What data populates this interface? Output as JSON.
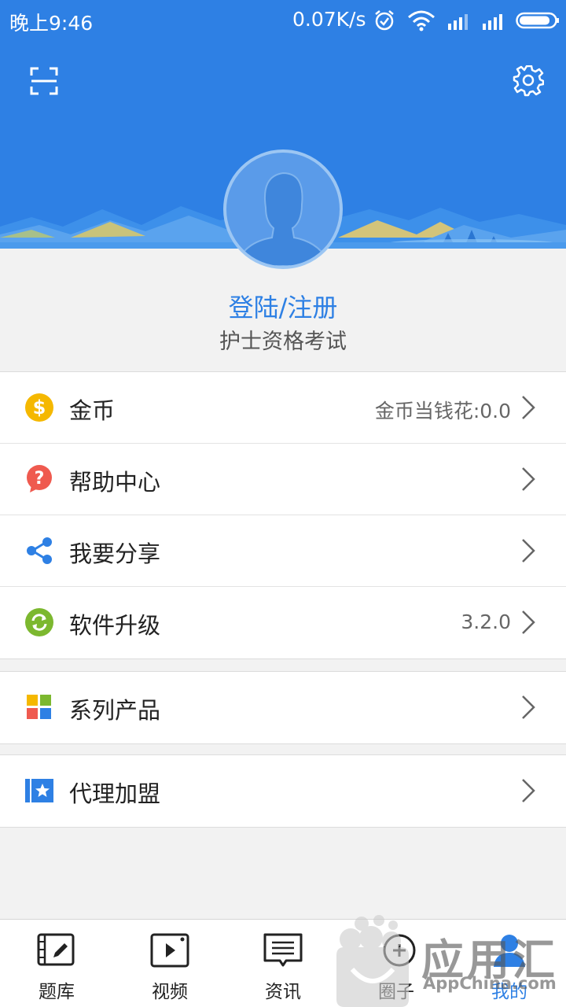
{
  "status_bar": {
    "time": "晚上9:46",
    "speed": "0.07K/s",
    "icons": [
      "alarm-icon",
      "wifi-icon",
      "signal-icon",
      "signal-icon",
      "battery-icon"
    ]
  },
  "header": {
    "scan_icon": "scan-icon",
    "settings_icon": "gear-icon",
    "avatar_icon": "user-avatar-icon",
    "color": "#2e80e4"
  },
  "profile": {
    "login_label": "登陆/注册",
    "exam_name": "护士资格考试"
  },
  "menu": {
    "group1": [
      {
        "icon": "dollar-coin-icon",
        "label": "金币",
        "value": "金币当钱花:0.0",
        "icon_color": "#f5b800"
      },
      {
        "icon": "question-bubble-icon",
        "label": "帮助中心",
        "value": "",
        "icon_color": "#ef5a4f"
      },
      {
        "icon": "share-icon",
        "label": "我要分享",
        "value": "",
        "icon_color": "#2e80e4"
      },
      {
        "icon": "refresh-icon",
        "label": "软件升级",
        "value": "3.2.0",
        "icon_color": "#7cb82f"
      }
    ],
    "group2": [
      {
        "icon": "grid-squares-icon",
        "label": "系列产品",
        "value": ""
      }
    ],
    "group3": [
      {
        "icon": "star-card-icon",
        "label": "代理加盟",
        "value": "",
        "icon_color": "#2e80e4"
      }
    ]
  },
  "tabbar": {
    "tabs": [
      {
        "label": "题库",
        "icon": "question-bank-icon",
        "active": false
      },
      {
        "label": "视频",
        "icon": "video-icon",
        "active": false
      },
      {
        "label": "资讯",
        "icon": "news-icon",
        "active": false
      },
      {
        "label": "圈子",
        "icon": "circle-plus-icon",
        "active": false
      },
      {
        "label": "我的",
        "icon": "profile-icon",
        "active": true
      }
    ],
    "active_color": "#2e80e4"
  },
  "watermark": {
    "text": "应用汇",
    "sub": "AppChina.com"
  }
}
